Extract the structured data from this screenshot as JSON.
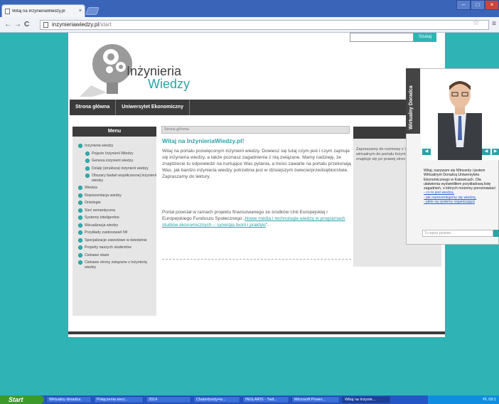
{
  "browser": {
    "tab_title": "Witaj na InzynieriaWiedzy.pl",
    "tab_close": "×",
    "url_host": "inzynieriawiedzy.pl",
    "url_path": "/start",
    "back": "←",
    "forward": "→",
    "reload": "C",
    "star": "☆",
    "menu": "≡",
    "win_min": "–",
    "win_max": "□",
    "win_close": "×"
  },
  "header": {
    "brand_line1": "Inżynieria",
    "brand_line2": "Wiedzy",
    "search_button": "Szukaj",
    "search_value": ""
  },
  "nav": {
    "items": [
      "Strona główna",
      "Uniwersytet Ekonomiczny"
    ]
  },
  "sidebar": {
    "title": "Menu",
    "items": [
      "Inżynieria wiedzy",
      "Pojęcie Inżynierii Wiedzy",
      "Geneza inżynierii wiedzy",
      "Działy (struktura) inżynierii wiedzy",
      "Obszary badań współczesnej inżynierii wiedzy",
      "Wiedza",
      "Reprezentacja wiedzy",
      "Ontologie",
      "Sieć semantyczna",
      "Systemy inteligentne",
      "Wizualizacja wiedzy",
      "Przykłady zastosowań IW",
      "Specjalizacje zawodowe w dziedzinie",
      "Projekty naszych studentów",
      "Ciekawe staże",
      "Ciekawe strony związane z inżynierią wiedzy"
    ]
  },
  "main": {
    "breadcrumb": "Strona główna",
    "title": "Witaj na InżynieriaWiedzy.pl!",
    "paragraph1": "Witaj na portalu poświęconym inżynierii wiedzy. Dowiesz się tutaj czym jest i czym zajmuje się inżynieria wiedzy, a także poznasz zagadnienia z nią związane. Mamy nadzieję, że znajdziecie tu odpowiedzi na nurtujące Was pytania, a treści zawarte na portalu przekonają Was, jak bardzo inżynieria wiedzy potrzebna jest w dzisiejszym świecie/przedsiębiorstwie. Zapraszamy do lektury.",
    "paragraph2_text": "Portal powstał w ramach projektu finansowanego ze środków Unii Europejskiej i Europejskiego Funduszu Społecznego „",
    "paragraph2_link": "Nowe media i technologie wiedzy w programach studiów ekonomicznych – synergia teorii i praktyki",
    "paragraph2_end": "”."
  },
  "right": {
    "text": "Zapraszamy do rozmowy z Wincentym - wirtualnym do portalu InżynieriaWiedzy.pl znajduje się po prawej stron"
  },
  "advisor": {
    "tab_label": "Wirtualny Doradca",
    "intro": "Witaj, nazywam się Wincenty i jestem Wirtualnym Doradcą Uniwersytetu Ekonomicznego w Katowicach. Dla ułatwienia wyświetliłem przykładową listę zagadnień, o których możemy porozmawiać:",
    "topics": [
      "- co to jest wiedza,",
      "- jak reprezentujemy się wiedzę,",
      "- jakie są systemy organizujące"
    ],
    "input_placeholder": "Tu wpisz pytanie...",
    "accent": "#2aa3a6"
  },
  "taskbar": {
    "start": "Start",
    "items": [
      "Wirtualny doradca",
      "Połączenia sieci...",
      "2014",
      "Chaterbooty+w...",
      "INGLARIS - Twit...",
      "Microsoft Power...",
      "Witaj na Inżynie..."
    ],
    "lang": "PL",
    "clock": "09:1"
  },
  "colors": {
    "teal": "#2fb3b4",
    "dark": "#3b3b3b",
    "panel": "#e6e6e6"
  }
}
